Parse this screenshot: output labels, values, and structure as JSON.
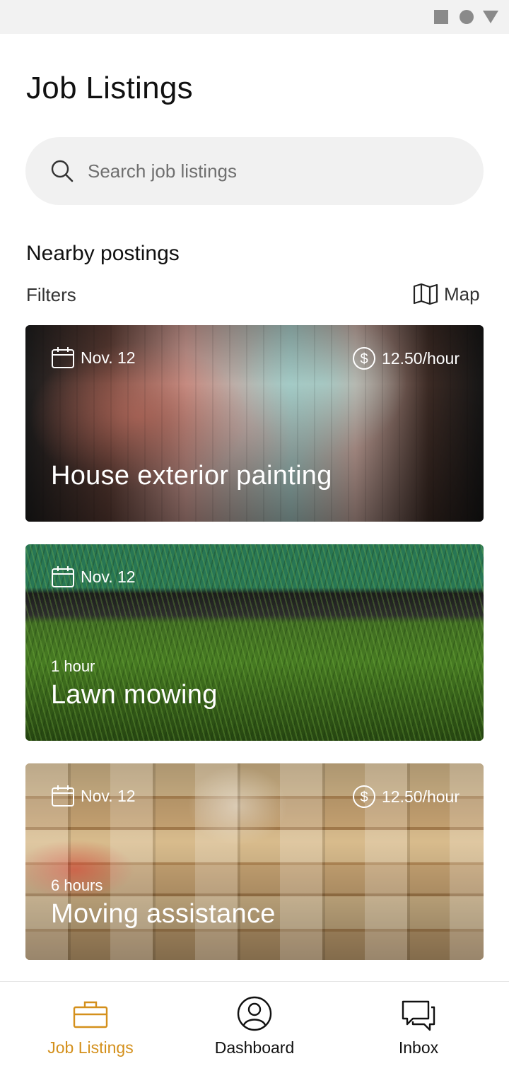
{
  "page": {
    "title": "Job Listings"
  },
  "search": {
    "placeholder": "Search job listings"
  },
  "section": {
    "title": "Nearby postings"
  },
  "filters": {
    "label": "Filters"
  },
  "map": {
    "label": "Map"
  },
  "listings": [
    {
      "date": "Nov. 12",
      "pay": "12.50/hour",
      "duration": "",
      "title": "House exterior painting"
    },
    {
      "date": "Nov. 12",
      "pay": "",
      "duration": "1 hour",
      "title": "Lawn mowing"
    },
    {
      "date": "Nov. 12",
      "pay": "12.50/hour",
      "duration": "6 hours",
      "title": "Moving assistance"
    }
  ],
  "tabs": [
    {
      "label": "Job Listings",
      "active": true,
      "icon": "briefcase-icon"
    },
    {
      "label": "Dashboard",
      "active": false,
      "icon": "user-circle-icon"
    },
    {
      "label": "Inbox",
      "active": false,
      "icon": "chat-icon"
    }
  ],
  "colors": {
    "accent": "#d4901c",
    "search_bg": "#f1f1f1"
  }
}
